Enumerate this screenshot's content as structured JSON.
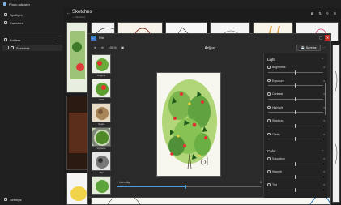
{
  "app": {
    "title": "Photo Adjuster"
  },
  "nav": {
    "items": [
      {
        "label": "Spotlight",
        "icon": "spotlight-icon"
      },
      {
        "label": "Favorites",
        "icon": "heart-icon"
      },
      {
        "label": "Folders",
        "icon": "folder-icon"
      },
      {
        "label": "Sketches",
        "icon": "folder-icon"
      }
    ],
    "settings_label": "Settings"
  },
  "main": {
    "folder_title": "Sketches",
    "folder_sub": "— Sketches",
    "toolbar": [
      "▦",
      "⇅",
      "⚲",
      "⊞"
    ]
  },
  "dialog": {
    "crumb": "Filte",
    "zoom_value": "100 %",
    "title": "Adjust",
    "save_label": "Save as",
    "more": "···",
    "filters": [
      {
        "label": "Original"
      },
      {
        "label": "HDR"
      },
      {
        "label": "Sepia"
      },
      {
        "label": "Vignette"
      },
      {
        "label": "BW"
      },
      {
        "label": ""
      }
    ],
    "intensity": {
      "label": "Intensity",
      "value": "0",
      "level": 0.48
    }
  },
  "panel": {
    "light_title": "Light",
    "light": [
      {
        "label": "Brightness",
        "value": "0",
        "level": 0.5
      },
      {
        "label": "Exposure",
        "value": "0",
        "level": 0.5
      },
      {
        "label": "Contrast",
        "value": "0",
        "level": 0.5
      },
      {
        "label": "Highlight",
        "value": "0",
        "level": 0.5
      },
      {
        "label": "Shadows",
        "value": "0",
        "level": 0.5
      },
      {
        "label": "Clarity",
        "value": "0",
        "level": 0.5
      }
    ],
    "color_title": "Color",
    "color": [
      {
        "label": "Saturation",
        "value": "0",
        "level": 0.5
      },
      {
        "label": "Warmth",
        "value": "0",
        "level": 0.5
      },
      {
        "label": "Tint",
        "value": "0",
        "level": 0.5
      }
    ]
  },
  "colors": {
    "accent": "#4c9ce0",
    "close": "#c42b1c"
  }
}
